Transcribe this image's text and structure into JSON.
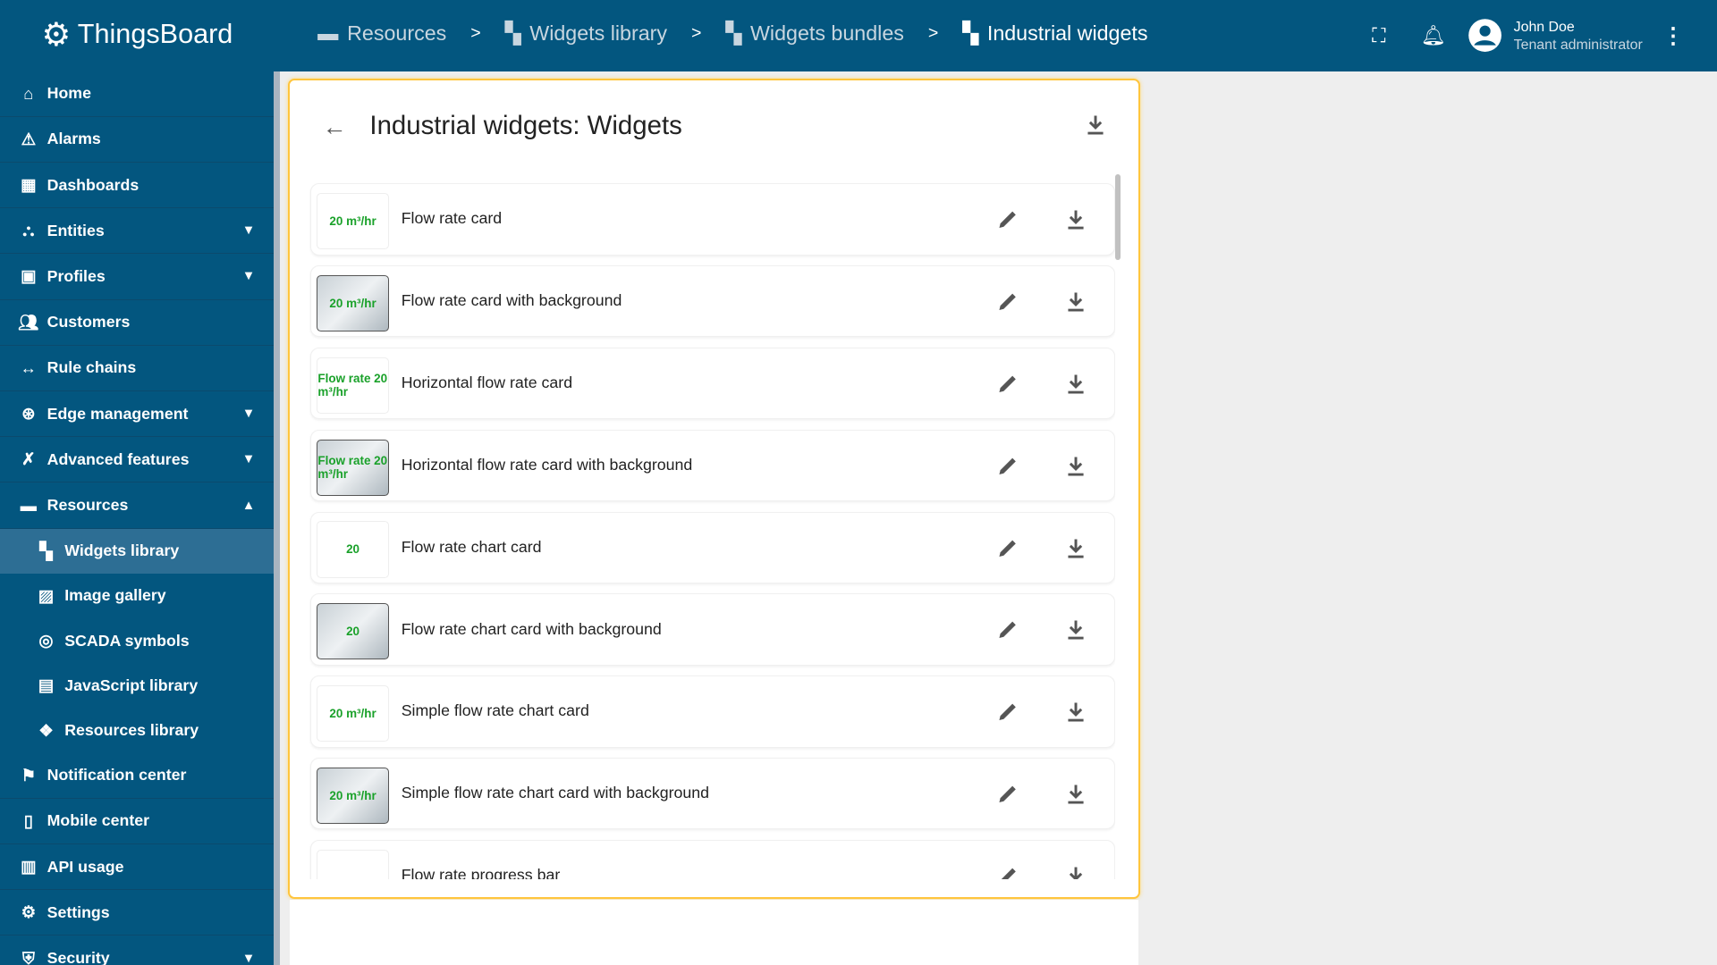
{
  "header": {
    "app_name": "ThingsBoard",
    "breadcrumbs": [
      {
        "label": "Resources",
        "icon": "folder-icon"
      },
      {
        "label": "Widgets library",
        "icon": "widgets-icon"
      },
      {
        "label": "Widgets bundles",
        "icon": "widgets-icon"
      },
      {
        "label": "Industrial widgets",
        "icon": "widgets-icon"
      }
    ],
    "separator": ">",
    "user": {
      "name": "John Doe",
      "role": "Tenant administrator"
    }
  },
  "sidebar": {
    "items": [
      {
        "label": "Home",
        "icon": "home-icon"
      },
      {
        "label": "Alarms",
        "icon": "warning-icon"
      },
      {
        "label": "Dashboards",
        "icon": "dashboard-icon"
      },
      {
        "label": "Entities",
        "icon": "entities-icon",
        "expandable": true
      },
      {
        "label": "Profiles",
        "icon": "profiles-icon",
        "expandable": true
      },
      {
        "label": "Customers",
        "icon": "customers-icon"
      },
      {
        "label": "Rule chains",
        "icon": "rule-chain-icon"
      },
      {
        "label": "Edge management",
        "icon": "edge-icon",
        "expandable": true
      },
      {
        "label": "Advanced features",
        "icon": "tools-icon",
        "expandable": true
      },
      {
        "label": "Resources",
        "icon": "folder-icon",
        "expanded": true
      }
    ],
    "sub_items": [
      {
        "label": "Widgets library",
        "selected": true
      },
      {
        "label": "Image gallery"
      },
      {
        "label": "SCADA symbols"
      },
      {
        "label": "JavaScript library"
      },
      {
        "label": "Resources library"
      }
    ],
    "bottom_items": [
      {
        "label": "Notification center"
      },
      {
        "label": "Mobile center"
      },
      {
        "label": "API usage"
      },
      {
        "label": "Settings"
      },
      {
        "label": "Security",
        "expandable": true
      }
    ]
  },
  "panel": {
    "title": "Industrial widgets: Widgets"
  },
  "widgets": [
    {
      "name": "Flow rate card",
      "thumb": "20 m³/hr",
      "bg": false
    },
    {
      "name": "Flow rate card with background",
      "thumb": "20 m³/hr",
      "bg": true
    },
    {
      "name": "Horizontal flow rate card",
      "thumb": "Flow rate 20 m³/hr",
      "bg": false
    },
    {
      "name": "Horizontal flow rate card with background",
      "thumb": "Flow rate 20 m³/hr",
      "bg": true
    },
    {
      "name": "Flow rate chart card",
      "thumb": "20",
      "bg": false
    },
    {
      "name": "Flow rate chart card with background",
      "thumb": "20",
      "bg": true
    },
    {
      "name": "Simple flow rate chart card",
      "thumb": "20 m³/hr",
      "bg": false
    },
    {
      "name": "Simple flow rate chart card with background",
      "thumb": "20 m³/hr",
      "bg": true
    },
    {
      "name": "Flow rate progress bar",
      "thumb": "",
      "bg": false
    }
  ],
  "colors": {
    "primary": "#03567f",
    "highlight": "#ffc53d",
    "value_green": "#1aa12a"
  }
}
